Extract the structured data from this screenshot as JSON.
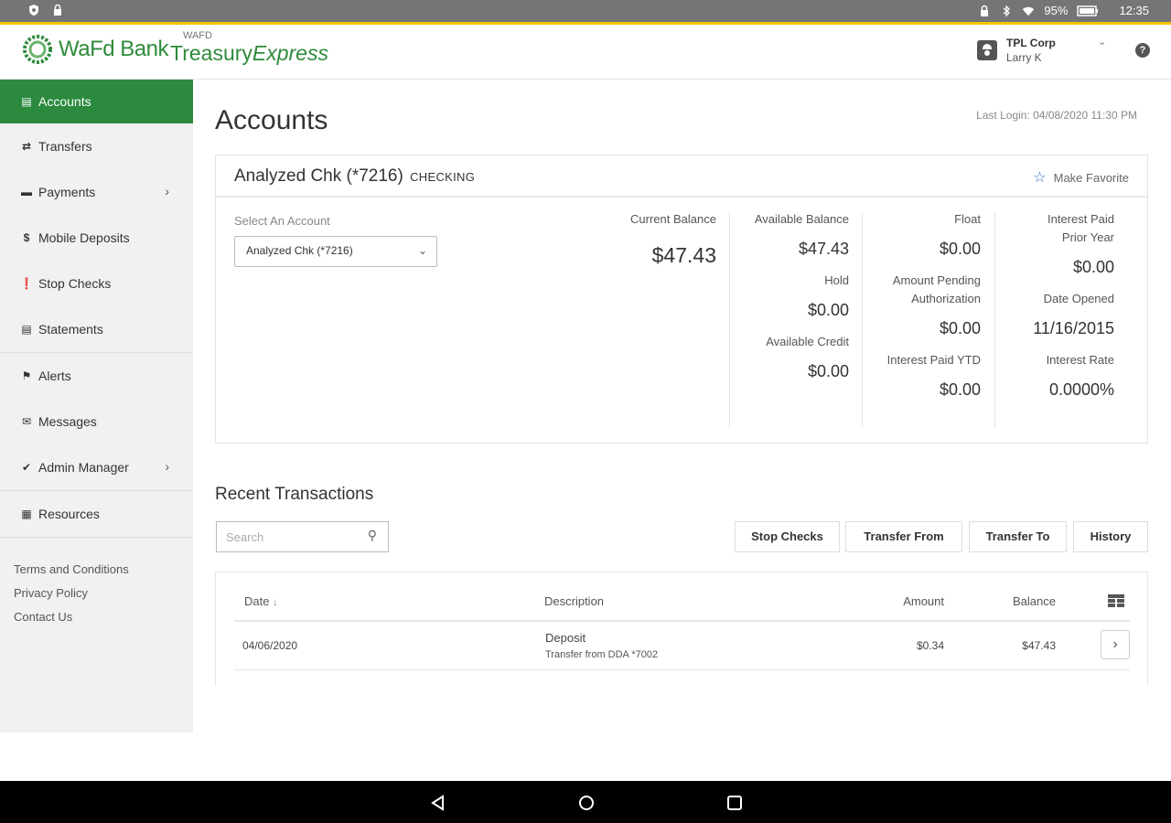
{
  "status_bar": {
    "battery": "95%",
    "time": "12:35"
  },
  "header": {
    "brand_name": "WaFd Bank",
    "product_small": "WAFD",
    "product_name_1": "Treasury",
    "product_name_2": "Express",
    "company": "TPL Corp",
    "user": "Larry K",
    "help_label": "?"
  },
  "sidebar": {
    "items": [
      {
        "label": "Accounts"
      },
      {
        "label": "Transfers"
      },
      {
        "label": "Payments"
      },
      {
        "label": "Mobile Deposits"
      },
      {
        "label": "Stop Checks"
      },
      {
        "label": "Statements"
      },
      {
        "label": "Alerts"
      },
      {
        "label": "Messages"
      },
      {
        "label": "Admin Manager"
      },
      {
        "label": "Resources"
      }
    ],
    "footer": [
      "Terms and Conditions",
      "Privacy Policy",
      "Contact Us"
    ]
  },
  "page": {
    "title": "Accounts",
    "last_login": "Last Login: 04/08/2020 11:30 PM"
  },
  "account": {
    "name": "Analyzed Chk (*7216)",
    "type": "CHECKING",
    "favorite_label": "Make Favorite",
    "select_label": "Select An Account",
    "selected": "Analyzed Chk (*7216)",
    "current_balance_label": "Current Balance",
    "current_balance": "$47.43",
    "available_balance_label": "Available Balance",
    "available_balance": "$47.43",
    "hold_label": "Hold",
    "hold": "$0.00",
    "available_credit_label": "Available Credit",
    "available_credit": "$0.00",
    "float_label": "Float",
    "float": "$0.00",
    "pending_label_1": "Amount Pending",
    "pending_label_2": "Authorization",
    "pending": "$0.00",
    "interest_ytd_label": "Interest Paid YTD",
    "interest_ytd": "$0.00",
    "interest_prior_label_1": "Interest Paid",
    "interest_prior_label_2": "Prior Year",
    "interest_prior": "$0.00",
    "date_opened_label": "Date Opened",
    "date_opened": "11/16/2015",
    "interest_rate_label": "Interest Rate",
    "interest_rate": "0.0000%"
  },
  "transactions": {
    "title": "Recent Transactions",
    "search_placeholder": "Search",
    "buttons": [
      "Stop Checks",
      "Transfer From",
      "Transfer To",
      "History"
    ],
    "columns": {
      "date": "Date",
      "description": "Description",
      "amount": "Amount",
      "balance": "Balance"
    },
    "rows": [
      {
        "date": "04/06/2020",
        "description": "Deposit",
        "detail": "Transfer from DDA *7002",
        "amount": "$0.34",
        "balance": "$47.43"
      }
    ]
  },
  "colors": {
    "brand_green": "#2b8a3e",
    "status_bar": "#757575",
    "accent_yellow": "#f2c300",
    "star_blue": "#2f6fb5"
  }
}
